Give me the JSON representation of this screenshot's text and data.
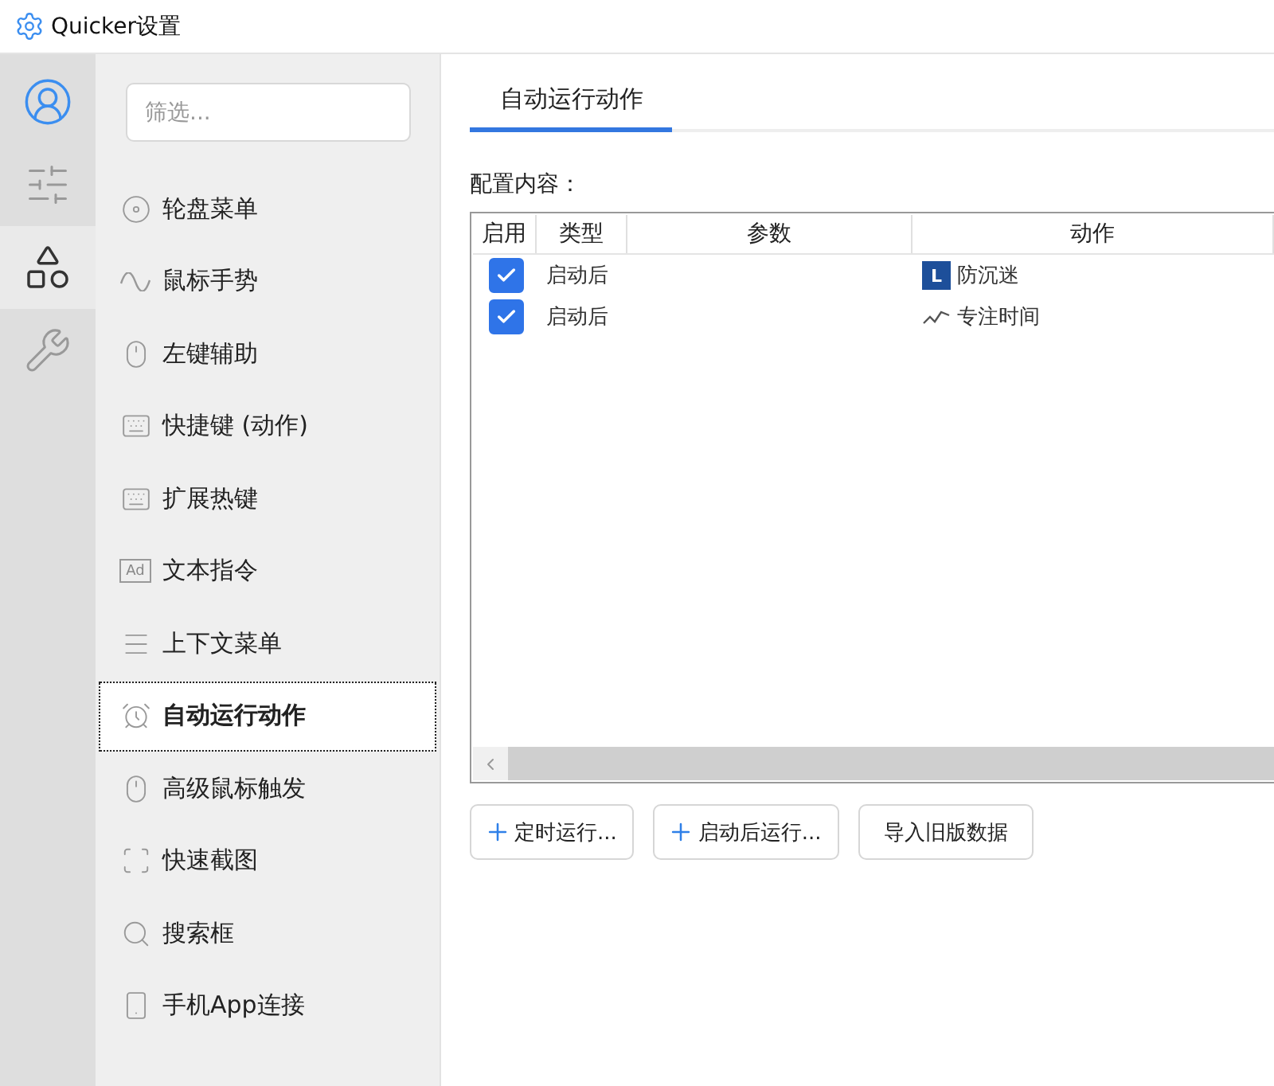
{
  "window": {
    "title": "Quicker设置"
  },
  "rail": [
    {
      "selected": false
    },
    {
      "selected": false
    },
    {
      "selected": true
    },
    {
      "selected": false
    }
  ],
  "filter": {
    "placeholder": "筛选..."
  },
  "nav": [
    {
      "label": "轮盘菜单",
      "selected": false
    },
    {
      "label": "鼠标手势",
      "selected": false
    },
    {
      "label": "左键辅助",
      "selected": false
    },
    {
      "label": "快捷键 (动作)",
      "selected": false
    },
    {
      "label": "扩展热键",
      "selected": false
    },
    {
      "label": "文本指令",
      "selected": false,
      "badge": "Ad"
    },
    {
      "label": "上下文菜单",
      "selected": false
    },
    {
      "label": "自动运行动作",
      "selected": true
    },
    {
      "label": "高级鼠标触发",
      "selected": false
    },
    {
      "label": "快速截图",
      "selected": false
    },
    {
      "label": "搜索框",
      "selected": false
    },
    {
      "label": "手机App连接",
      "selected": false
    }
  ],
  "tabs": [
    {
      "label": "自动运行动作",
      "selected": true
    }
  ],
  "section_label": "配置内容：",
  "table": {
    "columns": [
      "启用",
      "类型",
      "参数",
      "动作"
    ],
    "rows": [
      {
        "enabled": true,
        "type": "启动后",
        "action": {
          "label": "防沉迷",
          "badge": "L"
        }
      },
      {
        "enabled": true,
        "type": "启动后",
        "action": {
          "label": "专注时间"
        }
      }
    ]
  },
  "buttons": [
    {
      "label": "定时运行...",
      "plus": true
    },
    {
      "label": "启动后运行...",
      "plus": true
    },
    {
      "label": "导入旧版数据",
      "plus": false
    }
  ]
}
